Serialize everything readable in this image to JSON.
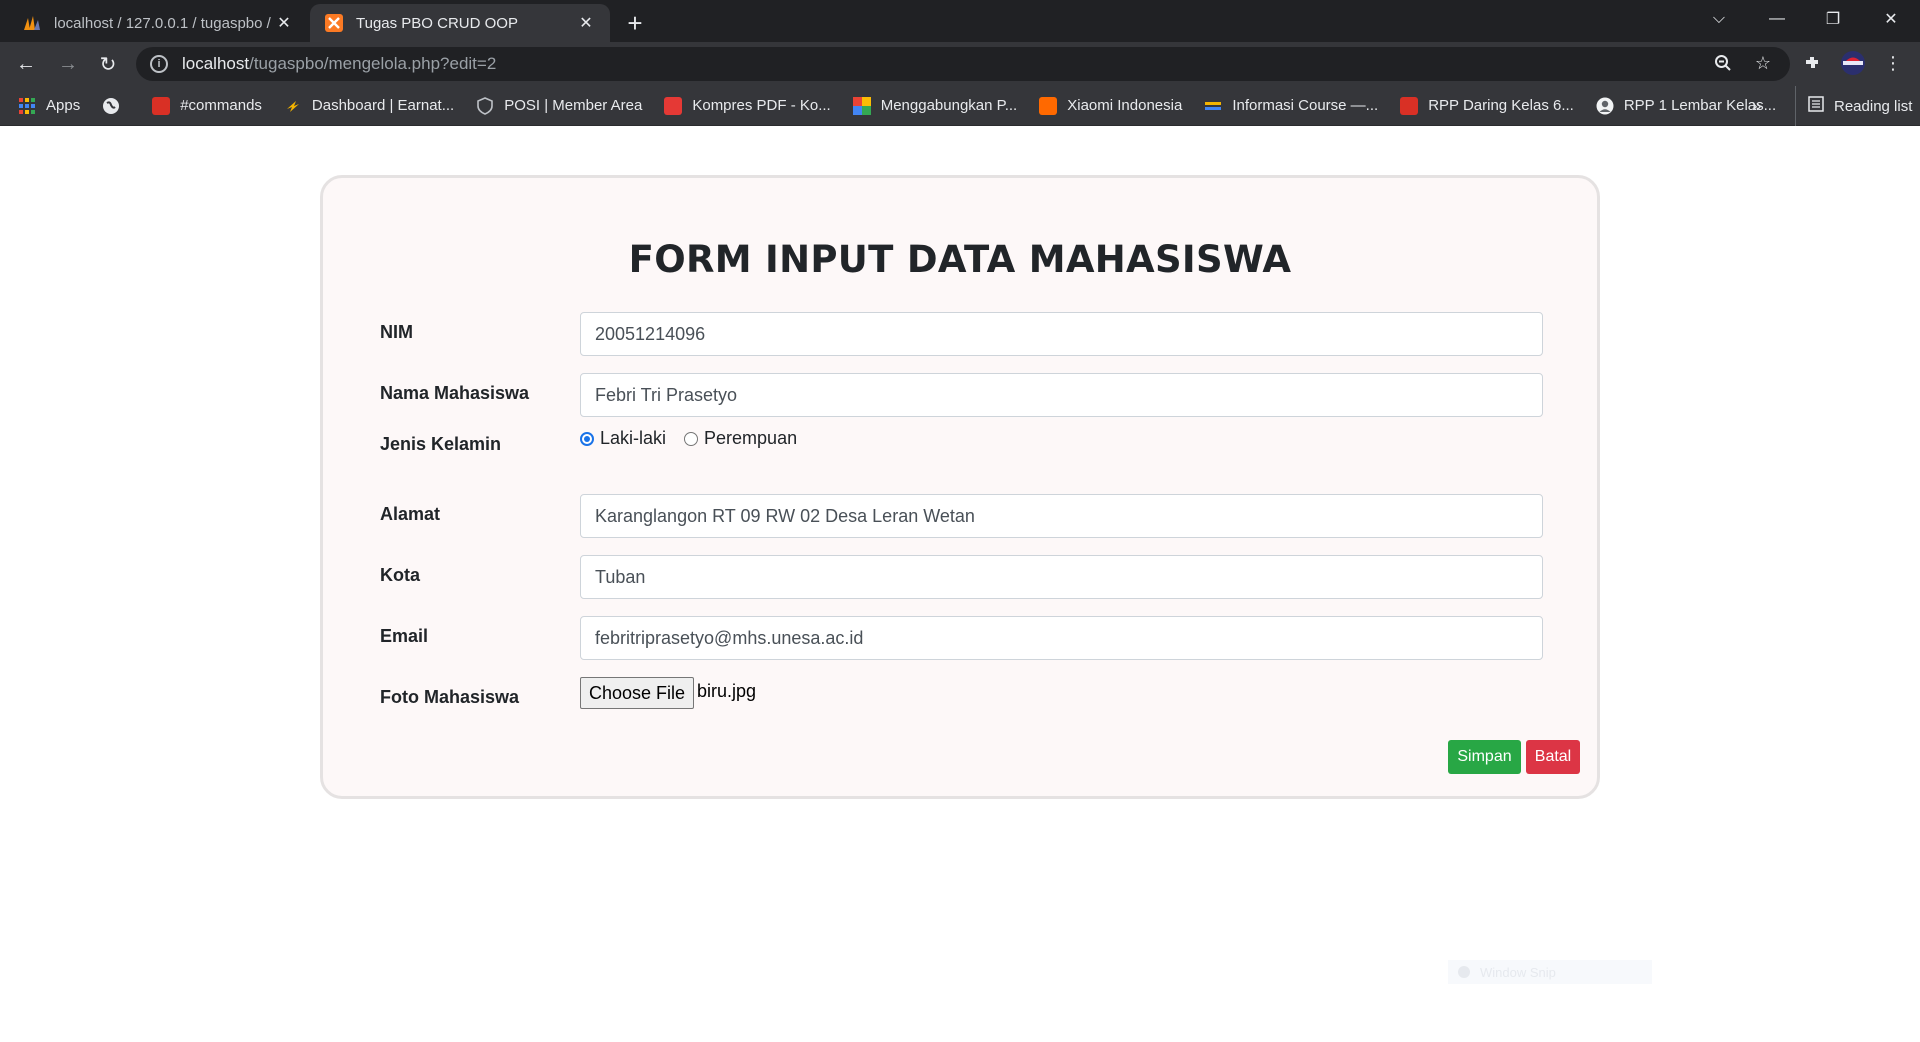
{
  "tabs": [
    {
      "title": "localhost / 127.0.0.1 / tugaspbo /",
      "active": false
    },
    {
      "title": "Tugas PBO CRUD OOP",
      "active": true
    }
  ],
  "address": {
    "host": "localhost",
    "path": "/tugaspbo/mengelola.php?edit=2"
  },
  "bookmarks": [
    {
      "label": "Apps",
      "icon": "apps-grid-icon",
      "color": "#ea4335"
    },
    {
      "label": "",
      "icon": "globe-icon",
      "color": "#e8eaed"
    },
    {
      "label": "#commands",
      "icon": "calendar-icon",
      "color": "#d93025"
    },
    {
      "label": "Dashboard | Earnat...",
      "icon": "earnat-icon",
      "color": "#f4b400"
    },
    {
      "label": "POSI | Member Area",
      "icon": "posi-icon",
      "color": "#9aa0a6"
    },
    {
      "label": "Kompres PDF - Ko...",
      "icon": "pdf-icon",
      "color": "#e53935"
    },
    {
      "label": "Menggabungkan P...",
      "icon": "merge-icon",
      "color": "#34a853"
    },
    {
      "label": "Xiaomi Indonesia",
      "icon": "xiaomi-icon",
      "color": "#ff6900"
    },
    {
      "label": "Informasi Course —...",
      "icon": "course-icon",
      "color": "#f4b400"
    },
    {
      "label": "RPP Daring Kelas 6...",
      "icon": "rpp-icon",
      "color": "#d93025"
    },
    {
      "label": "RPP 1 Lembar Kelas...",
      "icon": "person-icon",
      "color": "#f1f3f4"
    }
  ],
  "bookmarks_more": "»",
  "reading_list": "Reading list",
  "form": {
    "title": "FORM INPUT DATA MAHASISWA",
    "nim_label": "NIM",
    "nim_value": "20051214096",
    "nama_label": "Nama Mahasiswa",
    "nama_value": "Febri Tri Prasetyo",
    "jk_label": "Jenis Kelamin",
    "jk_options": [
      "Laki-laki",
      "Perempuan"
    ],
    "jk_selected": "Laki-laki",
    "alamat_label": "Alamat",
    "alamat_value": "Karanglangon RT 09 RW 02 Desa Leran Wetan",
    "kota_label": "Kota",
    "kota_value": "Tuban",
    "email_label": "Email",
    "email_value": "febritriprasetyo@mhs.unesa.ac.id",
    "foto_label": "Foto Mahasiswa",
    "file_button": "Choose File",
    "file_name": "biru.jpg",
    "save_label": "Simpan",
    "cancel_label": "Batal"
  },
  "overlay": {
    "snip_label": "Window Snip"
  },
  "colors": {
    "save": "#28a745",
    "cancel": "#dc3545",
    "radio": "#1a73e8"
  }
}
